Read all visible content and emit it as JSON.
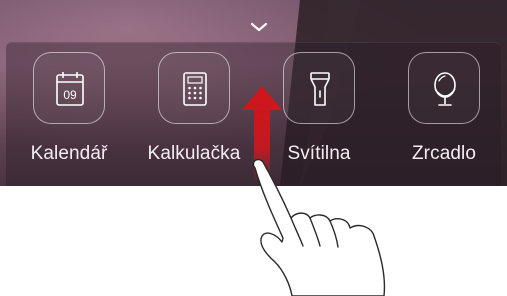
{
  "shortcuts": [
    {
      "label": "Kalendář",
      "icon": "calendar-icon",
      "date": "09"
    },
    {
      "label": "Kalkulačka",
      "icon": "calculator-icon"
    },
    {
      "label": "Svítilna",
      "icon": "flashlight-icon"
    },
    {
      "label": "Zrcadlo",
      "icon": "mirror-icon"
    }
  ],
  "handle_icon": "chevron-down-icon",
  "gesture": {
    "icon": "swipe-up-hand-icon",
    "arrow_icon": "up-arrow-icon",
    "arrow_color": "#d2151c"
  }
}
